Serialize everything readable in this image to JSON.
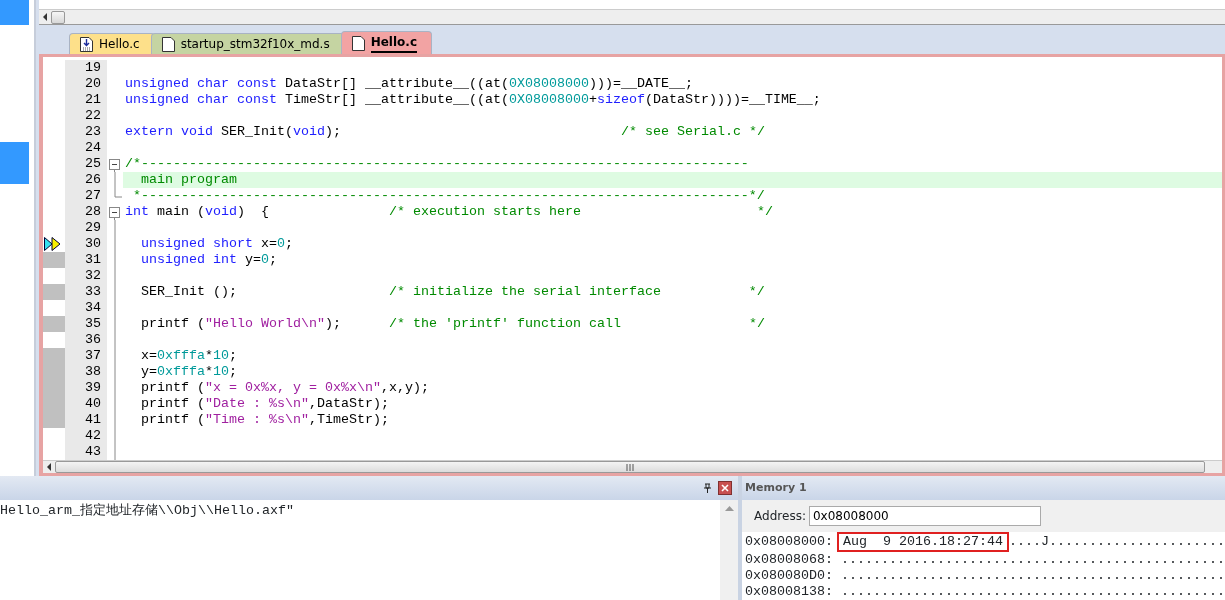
{
  "tabs": [
    {
      "label": "Hello.c",
      "color": "#fde08a",
      "kind": "loaded",
      "selected": false
    },
    {
      "label": "startup_stm32f10x_md.s",
      "color": "#c5d4a2",
      "kind": "plain",
      "selected": false
    },
    {
      "label": "Hello.c",
      "color": "#f2a3a3",
      "kind": "plain",
      "selected": true
    }
  ],
  "code_lines": [
    {
      "number": "19"
    },
    {
      "number": "20",
      "segments": [
        {
          "kind": "kw",
          "text": "unsigned char const"
        },
        {
          "kind": "tx",
          "text": " DataStr[] __attribute__((at("
        },
        {
          "kind": "num",
          "text": "0X08008000"
        },
        {
          "kind": "tx",
          "text": ")))=__DATE__;"
        }
      ]
    },
    {
      "number": "21",
      "segments": [
        {
          "kind": "kw",
          "text": "unsigned char const"
        },
        {
          "kind": "tx",
          "text": " TimeStr[] __attribute__((at("
        },
        {
          "kind": "num",
          "text": "0X08008000"
        },
        {
          "kind": "tx",
          "text": "+"
        },
        {
          "kind": "kw",
          "text": "sizeof"
        },
        {
          "kind": "tx",
          "text": "(DataStr))))=__TIME__;"
        }
      ]
    },
    {
      "number": "22"
    },
    {
      "number": "23",
      "segments": [
        {
          "kind": "kw",
          "text": "extern void"
        },
        {
          "kind": "tx",
          "text": " SER_Init("
        },
        {
          "kind": "kw",
          "text": "void"
        },
        {
          "kind": "tx",
          "text": ");                                   "
        },
        {
          "kind": "cm",
          "text": "/* see Serial.c */"
        }
      ]
    },
    {
      "number": "24"
    },
    {
      "number": "25",
      "fold_start": true,
      "segments": [
        {
          "kind": "cm",
          "text": "/*----------------------------------------------------------------------------"
        }
      ]
    },
    {
      "number": "26",
      "in_fold": true,
      "highlighted": true,
      "segments": [
        {
          "kind": "cm",
          "text": "  main program"
        }
      ]
    },
    {
      "number": "27",
      "fold_end": true,
      "segments": [
        {
          "kind": "cm",
          "text": " *----------------------------------------------------------------------------*/"
        }
      ]
    },
    {
      "number": "28",
      "fold_start": true,
      "segments": [
        {
          "kind": "kw",
          "text": "int"
        },
        {
          "kind": "tx",
          "text": " main ("
        },
        {
          "kind": "kw",
          "text": "void"
        },
        {
          "kind": "tx",
          "text": ")  {               "
        },
        {
          "kind": "cm",
          "text": "/* execution starts here                      */"
        }
      ]
    },
    {
      "number": "29",
      "in_fold": true
    },
    {
      "number": "30",
      "in_fold": true,
      "current": true,
      "executable": true,
      "segments": [
        {
          "kind": "kw",
          "text": "  unsigned short"
        },
        {
          "kind": "tx",
          "text": " x="
        },
        {
          "kind": "num",
          "text": "0"
        },
        {
          "kind": "tx",
          "text": ";"
        }
      ]
    },
    {
      "number": "31",
      "in_fold": true,
      "executable": true,
      "segments": [
        {
          "kind": "kw",
          "text": "  unsigned int"
        },
        {
          "kind": "tx",
          "text": " y="
        },
        {
          "kind": "num",
          "text": "0"
        },
        {
          "kind": "tx",
          "text": ";"
        }
      ]
    },
    {
      "number": "32",
      "in_fold": true
    },
    {
      "number": "33",
      "in_fold": true,
      "executable": true,
      "segments": [
        {
          "kind": "tx",
          "text": "  SER_Init ();                   "
        },
        {
          "kind": "cm",
          "text": "/* initialize the serial interface           */"
        }
      ]
    },
    {
      "number": "34",
      "in_fold": true
    },
    {
      "number": "35",
      "in_fold": true,
      "executable": true,
      "segments": [
        {
          "kind": "tx",
          "text": "  printf ("
        },
        {
          "kind": "str",
          "text": "\"Hello World\\n\""
        },
        {
          "kind": "tx",
          "text": ");      "
        },
        {
          "kind": "cm",
          "text": "/* the 'printf' function call                */"
        }
      ]
    },
    {
      "number": "36",
      "in_fold": true
    },
    {
      "number": "37",
      "in_fold": true,
      "executable": true,
      "segments": [
        {
          "kind": "tx",
          "text": "  x="
        },
        {
          "kind": "num",
          "text": "0xfffa"
        },
        {
          "kind": "tx",
          "text": "*"
        },
        {
          "kind": "num",
          "text": "10"
        },
        {
          "kind": "tx",
          "text": ";"
        }
      ]
    },
    {
      "number": "38",
      "in_fold": true,
      "executable": true,
      "segments": [
        {
          "kind": "tx",
          "text": "  y="
        },
        {
          "kind": "num",
          "text": "0xfffa"
        },
        {
          "kind": "tx",
          "text": "*"
        },
        {
          "kind": "num",
          "text": "10"
        },
        {
          "kind": "tx",
          "text": ";"
        }
      ]
    },
    {
      "number": "39",
      "in_fold": true,
      "executable": true,
      "segments": [
        {
          "kind": "tx",
          "text": "  printf ("
        },
        {
          "kind": "str",
          "text": "\"x = 0x%x, y = 0x%x\\n\""
        },
        {
          "kind": "tx",
          "text": ",x,y);"
        }
      ]
    },
    {
      "number": "40",
      "in_fold": true,
      "executable": true,
      "segments": [
        {
          "kind": "tx",
          "text": "  printf ("
        },
        {
          "kind": "str",
          "text": "\"Date : %s\\n\""
        },
        {
          "kind": "tx",
          "text": ",DataStr);"
        }
      ]
    },
    {
      "number": "41",
      "in_fold": true,
      "executable": true,
      "segments": [
        {
          "kind": "tx",
          "text": "  printf ("
        },
        {
          "kind": "str",
          "text": "\"Time : %s\\n\""
        },
        {
          "kind": "tx",
          "text": ",TimeStr);"
        }
      ]
    },
    {
      "number": "42",
      "in_fold": true
    },
    {
      "number": "43",
      "in_fold": true
    }
  ],
  "output": {
    "lines": [
      "Hello_arm_指定地址存储\\\\Obj\\\\Hello.axf\""
    ]
  },
  "memory": {
    "title": "Memory 1",
    "address_label": "Address:",
    "address": "0x08008000",
    "rows": [
      {
        "address": "0x08008000:",
        "boxed_text": "Aug  9 2016.18:27:44",
        "text": "....J......................"
      },
      {
        "address": "0x08008068:",
        "text": "................................................"
      },
      {
        "address": "0x080080D0:",
        "text": "................................................"
      },
      {
        "address": "0x08008138:",
        "text": "................................................"
      }
    ]
  }
}
